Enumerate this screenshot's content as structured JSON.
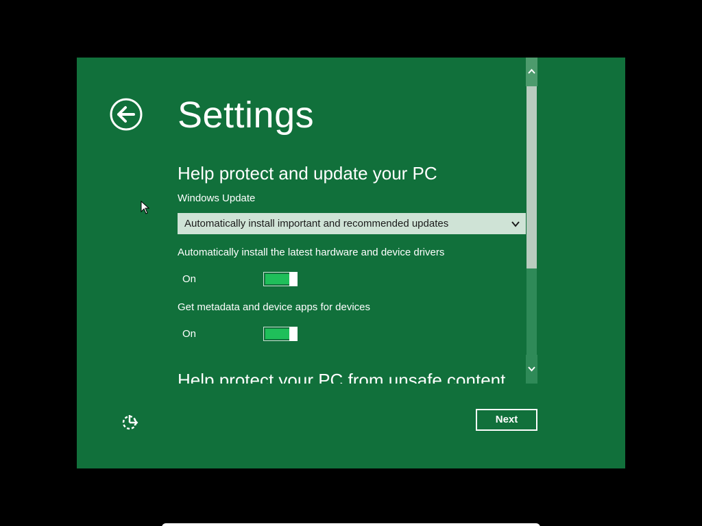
{
  "page": {
    "title": "Settings",
    "back_icon": "back-arrow-icon",
    "ease_of_access_icon": "ease-of-access-icon"
  },
  "sections": {
    "protect_update": {
      "heading": "Help protect and update your PC",
      "windows_update": {
        "label": "Windows Update",
        "selected_value": "Automatically install important and recommended updates"
      },
      "drivers": {
        "label": "Automatically install the latest hardware and device drivers",
        "state": "On",
        "enabled": true
      },
      "metadata": {
        "label": "Get metadata and device apps for devices",
        "state": "On",
        "enabled": true
      }
    },
    "unsafe_content": {
      "heading": "Help protect your PC from unsafe content"
    }
  },
  "footer": {
    "next_label": "Next"
  },
  "colors": {
    "background": "#11703b",
    "toggle_on": "#1fbf5a",
    "select_bg": "#cfe3d6",
    "text": "#ffffff"
  }
}
